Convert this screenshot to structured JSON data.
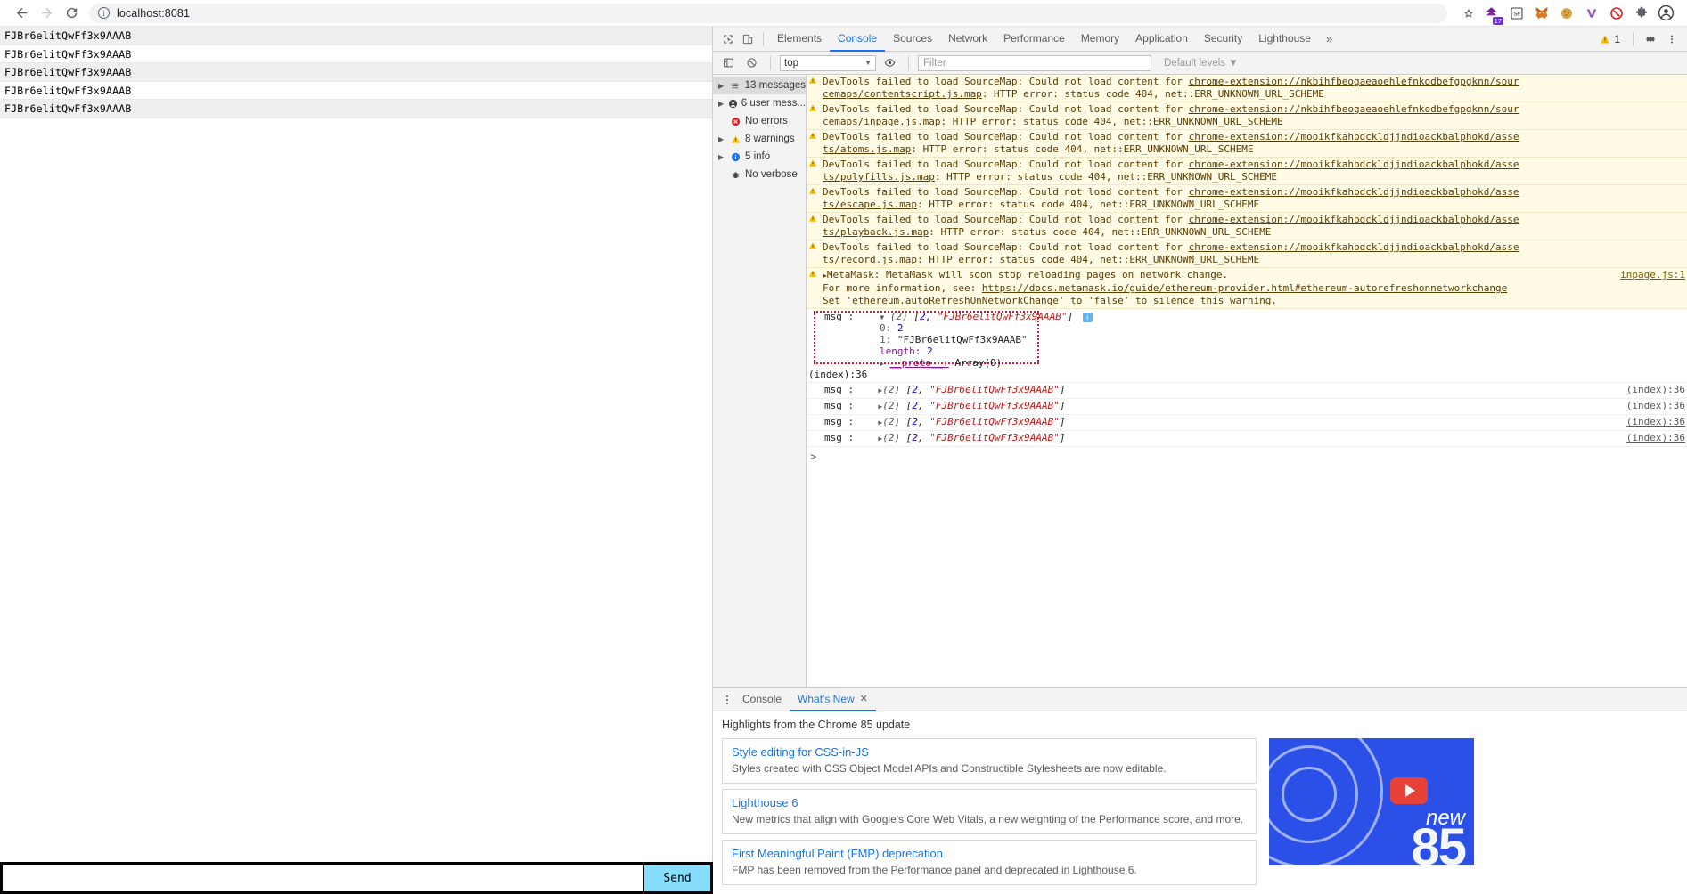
{
  "browser": {
    "back_label": "←",
    "forward_label": "→",
    "reload_label": "⟳",
    "url": "localhost:8081",
    "info_icon": "info-icon",
    "star_icon": "bookmark-star-icon",
    "extensions": [
      {
        "name": "purple-extension-icon",
        "badge": "17"
      },
      {
        "name": "selenium-icon",
        "badge": ""
      },
      {
        "name": "metamask-fox-icon",
        "badge": ""
      },
      {
        "name": "cookie-editor-icon",
        "badge": ""
      },
      {
        "name": "vimium-icon",
        "badge": ""
      },
      {
        "name": "adblock-icon",
        "badge": ""
      },
      {
        "name": "extensions-puzzle-icon",
        "badge": ""
      },
      {
        "name": "profile-avatar-icon",
        "badge": ""
      }
    ]
  },
  "page": {
    "messages": [
      "FJBr6elitQwFf3x9AAAB",
      "FJBr6elitQwFf3x9AAAB",
      "FJBr6elitQwFf3x9AAAB",
      "FJBr6elitQwFf3x9AAAB",
      "FJBr6elitQwFf3x9AAAB"
    ],
    "composer": {
      "value": "",
      "placeholder": "",
      "send_label": "Send"
    }
  },
  "devtools": {
    "inspect_icon": "inspect-element-icon",
    "device_icon": "device-toolbar-icon",
    "tabs": [
      {
        "label": "Elements",
        "active": false
      },
      {
        "label": "Console",
        "active": true
      },
      {
        "label": "Sources",
        "active": false
      },
      {
        "label": "Network",
        "active": false
      },
      {
        "label": "Performance",
        "active": false
      },
      {
        "label": "Memory",
        "active": false
      },
      {
        "label": "Application",
        "active": false
      },
      {
        "label": "Security",
        "active": false
      },
      {
        "label": "Lighthouse",
        "active": false
      }
    ],
    "more_tabs_label": "»",
    "warning_count": "1",
    "settings_icon": "gear-icon",
    "kebab_icon": "more-options-icon",
    "console_toolbar": {
      "sidebar_toggle_icon": "console-sidebar-icon",
      "clear_icon": "clear-console-icon",
      "context": "top",
      "eye_icon": "live-expression-icon",
      "filter_placeholder": "Filter",
      "levels_label": "Default levels"
    },
    "sidebar": [
      {
        "label": "13 messages",
        "icon": "list-icon",
        "expandable": true,
        "selected": true
      },
      {
        "label": "6 user mess...",
        "icon": "user-icon",
        "expandable": true,
        "selected": false
      },
      {
        "label": "No errors",
        "icon": "error-icon",
        "expandable": false,
        "selected": false
      },
      {
        "label": "8 warnings",
        "icon": "warning-icon",
        "expandable": true,
        "selected": false
      },
      {
        "label": "5 info",
        "icon": "info-icon",
        "expandable": true,
        "selected": false
      },
      {
        "label": "No verbose",
        "icon": "verbose-bug-icon",
        "expandable": false,
        "selected": false
      }
    ],
    "warnings": [
      {
        "prefix": "DevTools failed to load SourceMap: Could not load content for ",
        "link": "chrome-extension://nkbihfbeogaeaoehlefnkodbefgpgknn/sour",
        "link2": "cemaps/contentscript.js.map",
        "suffix": ": HTTP error: status code 404, net::ERR_UNKNOWN_URL_SCHEME",
        "source": ""
      },
      {
        "prefix": "DevTools failed to load SourceMap: Could not load content for ",
        "link": "chrome-extension://nkbihfbeogaeaoehlefnkodbefgpgknn/sour",
        "link2": "cemaps/inpage.js.map",
        "suffix": ": HTTP error: status code 404, net::ERR_UNKNOWN_URL_SCHEME",
        "source": ""
      },
      {
        "prefix": "DevTools failed to load SourceMap: Could not load content for ",
        "link": "chrome-extension://mooikfkahbdckldjjndioackbalphokd/asse",
        "link2": "ts/atoms.js.map",
        "suffix": ": HTTP error: status code 404, net::ERR_UNKNOWN_URL_SCHEME",
        "source": ""
      },
      {
        "prefix": "DevTools failed to load SourceMap: Could not load content for ",
        "link": "chrome-extension://mooikfkahbdckldjjndioackbalphokd/asse",
        "link2": "ts/polyfills.js.map",
        "suffix": ": HTTP error: status code 404, net::ERR_UNKNOWN_URL_SCHEME",
        "source": ""
      },
      {
        "prefix": "DevTools failed to load SourceMap: Could not load content for ",
        "link": "chrome-extension://mooikfkahbdckldjjndioackbalphokd/asse",
        "link2": "ts/escape.js.map",
        "suffix": ": HTTP error: status code 404, net::ERR_UNKNOWN_URL_SCHEME",
        "source": ""
      },
      {
        "prefix": "DevTools failed to load SourceMap: Could not load content for ",
        "link": "chrome-extension://mooikfkahbdckldjjndioackbalphokd/asse",
        "link2": "ts/playback.js.map",
        "suffix": ": HTTP error: status code 404, net::ERR_UNKNOWN_URL_SCHEME",
        "source": ""
      },
      {
        "prefix": "DevTools failed to load SourceMap: Could not load content for ",
        "link": "chrome-extension://mooikfkahbdckldjjndioackbalphokd/asse",
        "link2": "ts/record.js.map",
        "suffix": ": HTTP error: status code 404, net::ERR_UNKNOWN_URL_SCHEME",
        "source": ""
      }
    ],
    "metamask_warning": {
      "line1": "MetaMask: MetaMask will soon stop reloading pages on network change.",
      "line2_prefix": "For more information, see: ",
      "line2_link": "https://docs.metamask.io/guide/ethereum-provider.html#ethereum-autorefreshonnetworkchange",
      "line3": "Set 'ethereum.autoRefreshOnNetworkChange' to 'false' to silence this warning.",
      "source": "inpage.js:1"
    },
    "expanded_msg": {
      "label": "msg :",
      "count": "(2)",
      "preview_open": "[",
      "preview_num": "2",
      "preview_comma": ", ",
      "preview_str": "\"FJBr6elitQwFf3x9AAAB\"",
      "preview_close": "]",
      "props": [
        {
          "key": "0:",
          "value": "2",
          "type": "num"
        },
        {
          "key": "1:",
          "value": "\"FJBr6elitQwFf3x9AAAB\"",
          "type": "plain"
        },
        {
          "key": "length:",
          "value": "2",
          "type": "num"
        },
        {
          "key": "__proto__:",
          "value": "Array(0)",
          "type": "plain"
        }
      ],
      "source": "(index):36"
    },
    "collapsed_msgs": [
      {
        "label": "msg :",
        "count": "(2)",
        "num": "2",
        "str": "\"FJBr6elitQwFf3x9AAAB\"",
        "source": "(index):36"
      },
      {
        "label": "msg :",
        "count": "(2)",
        "num": "2",
        "str": "\"FJBr6elitQwFf3x9AAAB\"",
        "source": "(index):36"
      },
      {
        "label": "msg :",
        "count": "(2)",
        "num": "2",
        "str": "\"FJBr6elitQwFf3x9AAAB\"",
        "source": "(index):36"
      },
      {
        "label": "msg :",
        "count": "(2)",
        "num": "2",
        "str": "\"FJBr6elitQwFf3x9AAAB\"",
        "source": "(index):36"
      }
    ],
    "prompt_symbol": ">",
    "drawer": {
      "tabs": [
        {
          "label": "Console",
          "active": false,
          "closable": false
        },
        {
          "label": "What's New",
          "active": true,
          "closable": true
        }
      ],
      "close_label": "✕",
      "heading": "Highlights from the Chrome 85 update",
      "cards": [
        {
          "title": "Style editing for CSS-in-JS",
          "desc": "Styles created with CSS Object Model APIs and Constructible Stylesheets are now editable."
        },
        {
          "title": "Lighthouse 6",
          "desc": "New metrics that align with Google's Core Web Vitals, a new weighting of the Performance score, and more."
        },
        {
          "title": "First Meaningful Paint (FMP) deprecation",
          "desc": "FMP has been removed from the Performance panel and deprecated in Lighthouse 6."
        }
      ],
      "video": {
        "name": "whats-new-video-thumbnail",
        "new_label": "new",
        "version_label": "85"
      }
    }
  },
  "colors": {
    "accent": "#1a73e8",
    "warning_bg": "#fffbe5",
    "warning_text": "#5c3c00",
    "highlight_border": "#e81123",
    "send_button": "#87ddfc",
    "string_literal": "#c41a16",
    "number_literal": "#1c00cf",
    "property_key": "#881391"
  }
}
